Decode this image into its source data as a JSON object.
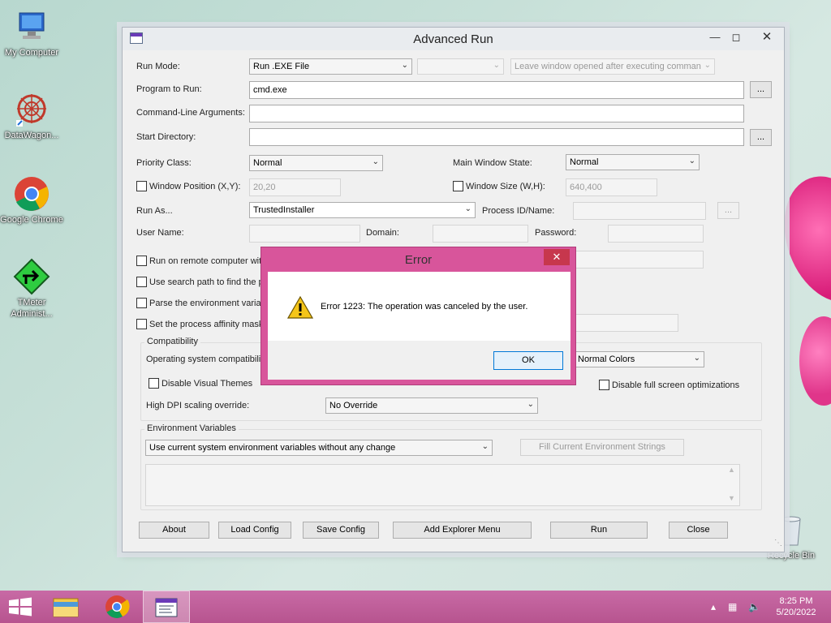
{
  "desktop": {
    "icons": [
      {
        "label": "My Computer"
      },
      {
        "label": "DataWagon..."
      },
      {
        "label": "Google Chrome"
      },
      {
        "label": "TMeter Administ..."
      },
      {
        "label": "Recycle Bin"
      }
    ]
  },
  "window": {
    "title": "Advanced Run",
    "labels": {
      "run_mode": "Run Mode:",
      "program": "Program to Run:",
      "args": "Command-Line Arguments:",
      "start_dir": "Start Directory:",
      "priority": "Priority Class:",
      "main_window_state": "Main Window State:",
      "run_as": "Run As...",
      "process_id": "Process ID/Name:",
      "user_name": "User Name:",
      "domain": "Domain:",
      "password": "Password:",
      "os_compat": "Operating system compatibili",
      "high_dpi": "High DPI scaling override:"
    },
    "values": {
      "run_mode": "Run .EXE File",
      "leave_window": "Leave window opened after executing comman",
      "program": "cmd.exe",
      "args": "",
      "start_dir": "",
      "priority": "Normal",
      "main_window_state": "Normal",
      "window_position": "20,20",
      "window_size": "640,400",
      "run_as": "TrustedInstaller",
      "colors": "Normal Colors",
      "high_dpi": "No Override",
      "env_vars": "Use current system environment variables without any change"
    },
    "checkboxes": {
      "window_position": "Window Position (X,Y):",
      "window_size": "Window Size (W,H):",
      "remote": "Run on remote computer wit",
      "search_path": "Use search path to find the p",
      "parse_env": "Parse the environment variat",
      "affinity": "Set the process affinity mask",
      "disable_themes": "Disable Visual Themes",
      "disable_fullscreen": "Disable full screen optimizations"
    },
    "groups": {
      "compat": "Compatibility",
      "env": "Environment Variables"
    },
    "buttons": {
      "browse": "...",
      "fill_env": "Fill Current Environment Strings",
      "about": "About",
      "load": "Load Config",
      "save": "Save Config",
      "explorer": "Add Explorer Menu",
      "run": "Run",
      "close": "Close"
    }
  },
  "dialog": {
    "title": "Error",
    "message": "Error 1223: The operation was canceled by the user.",
    "ok": "OK"
  },
  "taskbar": {
    "time": "8:25 PM",
    "date": "5/20/2022"
  }
}
